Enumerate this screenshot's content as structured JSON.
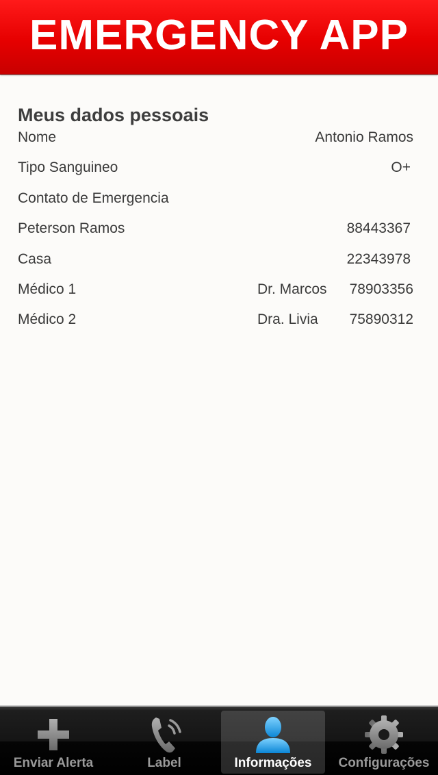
{
  "header": {
    "title": "EMERGENCY APP"
  },
  "personal": {
    "section_title": "Meus dados pessoais",
    "rows": [
      {
        "label": "Nome",
        "value": "Antonio Ramos"
      },
      {
        "label": "Tipo Sanguineo",
        "value": "O+"
      },
      {
        "label": "Contato de Emergencia",
        "value": ""
      },
      {
        "label": "Peterson Ramos",
        "value": "88443367"
      },
      {
        "label": "Casa",
        "value": "22343978"
      },
      {
        "label": "Médico 1",
        "doctor": "Dr. Marcos",
        "value": "78903356"
      },
      {
        "label": "Médico 2",
        "doctor": "Dra. Livia",
        "value": "75890312"
      }
    ]
  },
  "tabbar": {
    "tabs": [
      {
        "label": "Enviar Alerta",
        "icon": "plus-icon"
      },
      {
        "label": "Label",
        "icon": "phone-icon"
      },
      {
        "label": "Informações",
        "icon": "person-icon",
        "active": true
      },
      {
        "label": "Configurações",
        "icon": "gear-icon"
      }
    ]
  },
  "colors": {
    "header": "#e60000",
    "background": "#fcfbf9",
    "tab_active_icon": "#1fa3ea"
  }
}
